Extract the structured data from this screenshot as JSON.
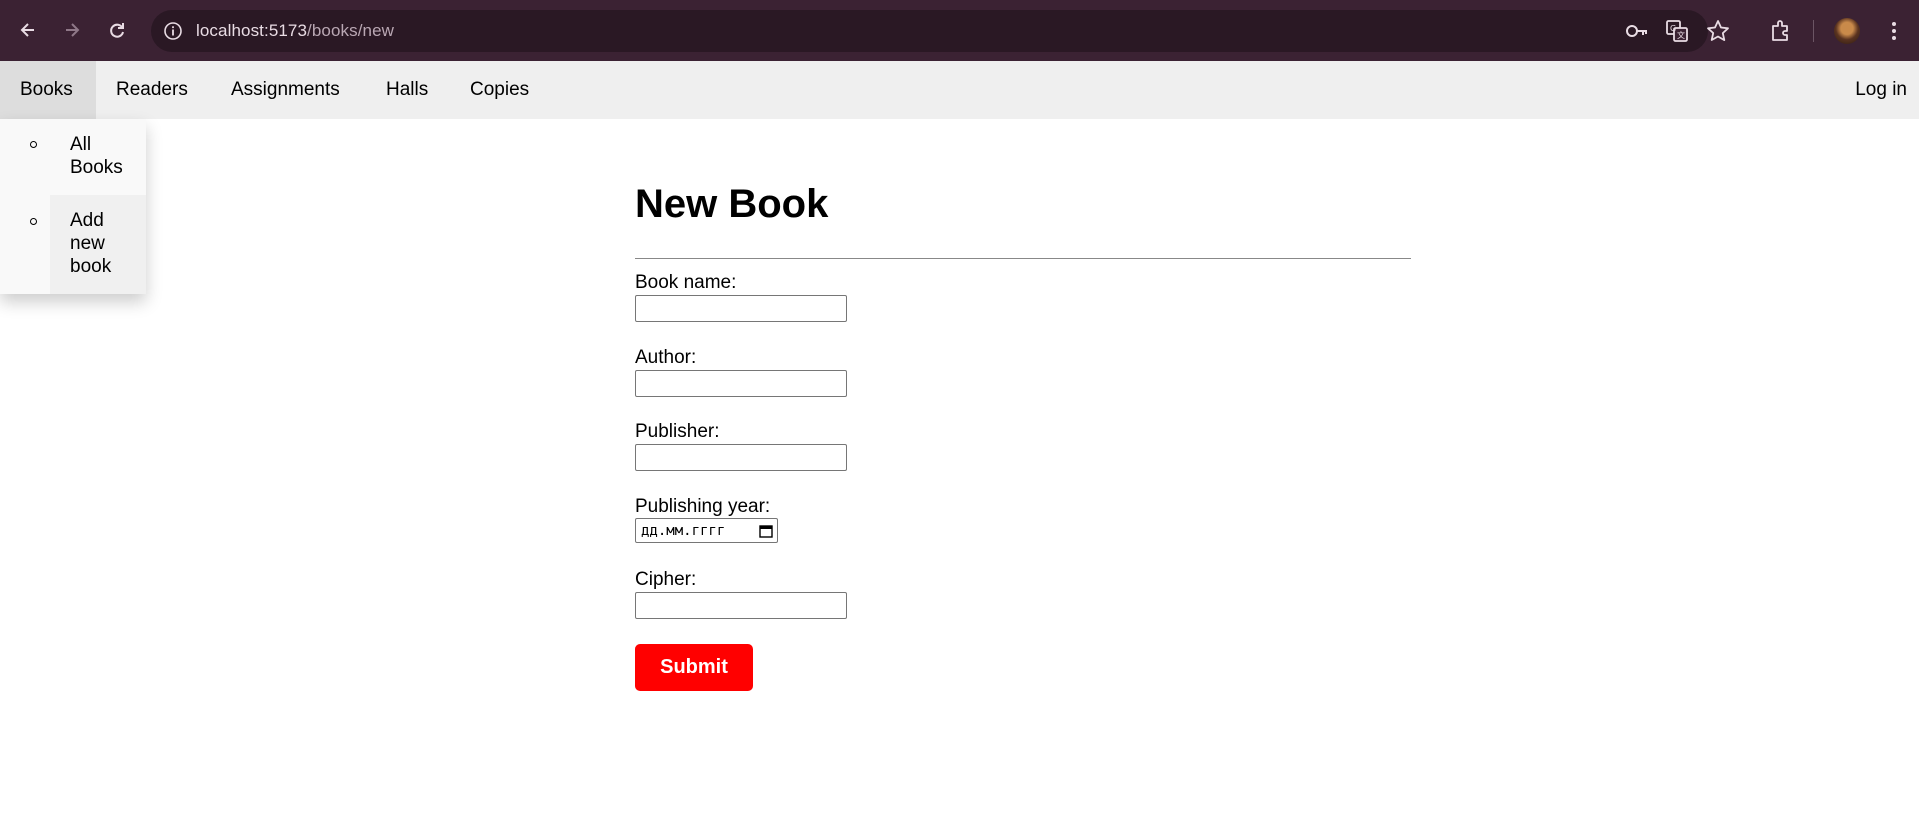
{
  "browser": {
    "url_host": "localhost:5173",
    "url_path": "/books/new",
    "icons": [
      "back-icon",
      "forward-icon",
      "reload-icon",
      "site-info-icon",
      "password-key-icon",
      "translate-icon",
      "bookmark-star-icon",
      "extensions-icon",
      "profile-avatar",
      "menu-icon"
    ]
  },
  "nav": {
    "items": [
      {
        "label": "Books"
      },
      {
        "label": "Readers"
      },
      {
        "label": "Assignments"
      },
      {
        "label": "Halls"
      },
      {
        "label": "Copies"
      }
    ],
    "login_label": "Log in"
  },
  "dropdown": {
    "items": [
      {
        "label_lines": [
          "All",
          "Books"
        ]
      },
      {
        "label_lines": [
          "Add",
          "new",
          "book"
        ]
      }
    ]
  },
  "form": {
    "title": "New Book",
    "fields": [
      {
        "label": "Book name:",
        "value": ""
      },
      {
        "label": "Author:",
        "value": ""
      },
      {
        "label": "Publisher:",
        "value": ""
      },
      {
        "label": "Publishing year:",
        "placeholder": "дд.мм.гггг"
      },
      {
        "label": "Cipher:",
        "value": ""
      }
    ],
    "submit_label": "Submit"
  },
  "colors": {
    "chrome_bg": "#3b2233",
    "nav_bg": "#efefef",
    "submit_bg": "#ff0000"
  }
}
